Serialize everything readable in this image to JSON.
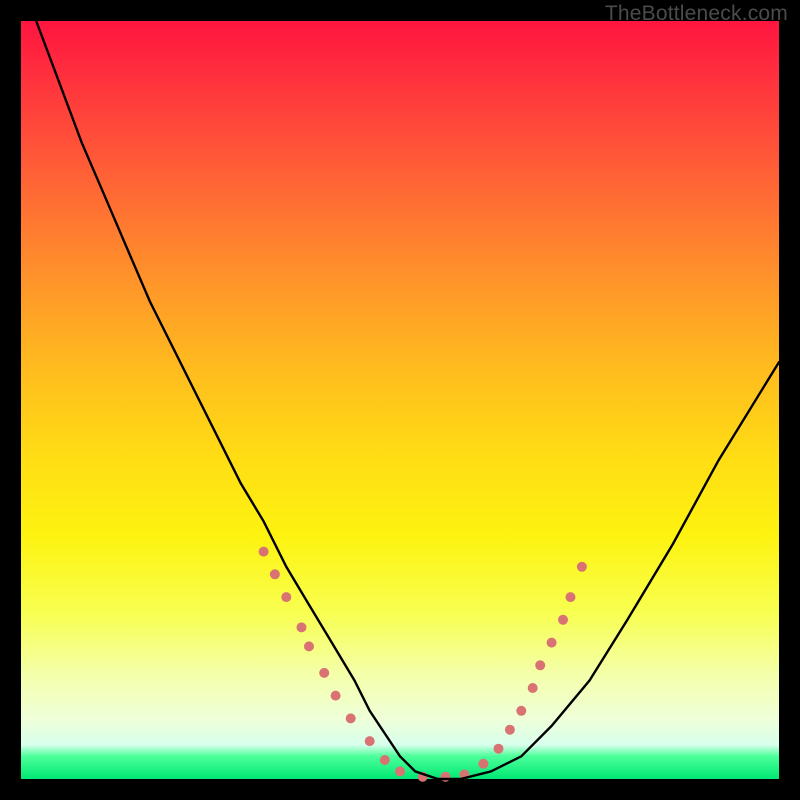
{
  "watermark": "TheBottleneck.com",
  "chart_data": {
    "type": "line",
    "title": "",
    "xlabel": "",
    "ylabel": "",
    "xlim": [
      0,
      100
    ],
    "ylim": [
      0,
      100
    ],
    "grid": false,
    "legend": false,
    "background_gradient_stops": [
      {
        "pct": 0,
        "color": "#ff153f"
      },
      {
        "pct": 18,
        "color": "#ff5838"
      },
      {
        "pct": 45,
        "color": "#ffb91f"
      },
      {
        "pct": 68,
        "color": "#fdf310"
      },
      {
        "pct": 92,
        "color": "#efffd8"
      },
      {
        "pct": 97,
        "color": "#4cff9a"
      },
      {
        "pct": 100,
        "color": "#00e873"
      }
    ],
    "series": [
      {
        "name": "bottleneck-curve",
        "x": [
          2,
          5,
          8,
          11,
          14,
          17,
          20,
          23,
          26,
          29,
          32,
          35,
          38,
          41,
          44,
          46,
          48,
          50,
          52,
          55,
          58,
          62,
          66,
          70,
          75,
          80,
          86,
          92,
          100
        ],
        "y": [
          100,
          92,
          84,
          77,
          70,
          63,
          57,
          51,
          45,
          39,
          34,
          28,
          23,
          18,
          13,
          9,
          6,
          3,
          1,
          0,
          0,
          1,
          3,
          7,
          13,
          21,
          31,
          42,
          55
        ]
      }
    ],
    "scatter_overlay": {
      "name": "dotted-segments",
      "color": "#d97373",
      "radius_px": 5,
      "points": [
        {
          "x": 32,
          "y": 30
        },
        {
          "x": 33.5,
          "y": 27
        },
        {
          "x": 35,
          "y": 24
        },
        {
          "x": 37,
          "y": 20
        },
        {
          "x": 38,
          "y": 17.5
        },
        {
          "x": 40,
          "y": 14
        },
        {
          "x": 41.5,
          "y": 11
        },
        {
          "x": 43.5,
          "y": 8
        },
        {
          "x": 46,
          "y": 5
        },
        {
          "x": 48,
          "y": 2.5
        },
        {
          "x": 50,
          "y": 1
        },
        {
          "x": 53,
          "y": 0.3
        },
        {
          "x": 56,
          "y": 0.3
        },
        {
          "x": 58.5,
          "y": 0.6
        },
        {
          "x": 61,
          "y": 2
        },
        {
          "x": 63,
          "y": 4
        },
        {
          "x": 64.5,
          "y": 6.5
        },
        {
          "x": 66,
          "y": 9
        },
        {
          "x": 67.5,
          "y": 12
        },
        {
          "x": 68.5,
          "y": 15
        },
        {
          "x": 70,
          "y": 18
        },
        {
          "x": 71.5,
          "y": 21
        },
        {
          "x": 72.5,
          "y": 24
        },
        {
          "x": 74,
          "y": 28
        }
      ]
    }
  }
}
